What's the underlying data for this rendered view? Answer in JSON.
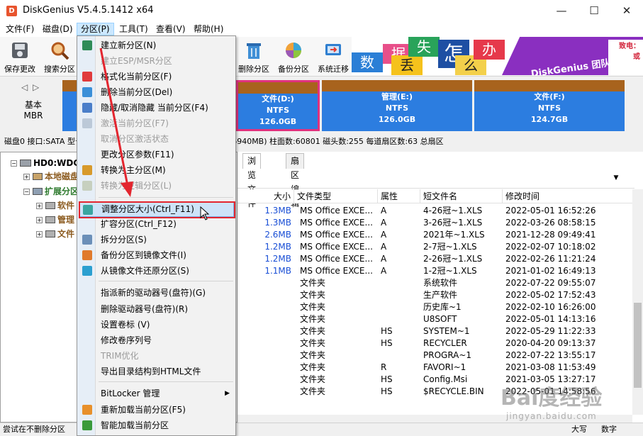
{
  "window": {
    "title": "DiskGenius V5.4.5.1412 x64",
    "minimize": "—",
    "maximize": "☐",
    "close": "✕"
  },
  "menubar": [
    "文件(F)",
    "磁盘(D)",
    "分区(P)",
    "工具(T)",
    "查看(V)",
    "帮助(H)"
  ],
  "toolbar": {
    "buttons": [
      {
        "label": "保存更改",
        "icon": "save-disk-icon"
      },
      {
        "label": "搜索分区",
        "icon": "magnifier-icon"
      },
      {
        "label": "删除分区",
        "icon": "trash-icon"
      },
      {
        "label": "备份分区",
        "icon": "backup-icon"
      },
      {
        "label": "系统迁移",
        "icon": "migrate-icon"
      }
    ],
    "banner": {
      "tiles": [
        "数",
        "据",
        "丢",
        "失",
        "怎",
        "么",
        "办"
      ],
      "slogan": "DiskGenius 团队为您服务",
      "right_line1": "致电：",
      "right_line2": "或"
    }
  },
  "diskbar": {
    "nav_left": "◁",
    "nav_right": "▷",
    "mbr_line1": "基本",
    "mbr_line2": "MBR",
    "partitions": [
      {
        "name": "文件(D:)",
        "fs": "NTFS",
        "size": "126.0GB"
      },
      {
        "name": "管理(E:)",
        "fs": "NTFS",
        "size": "126.0GB"
      },
      {
        "name": "文件(F:)",
        "fs": "NTFS",
        "size": "124.7GB"
      }
    ]
  },
  "disk_info": "磁盘0 接口:SATA  型号:WD-WCC2EP2L88C8  容量:465.8GB(476940MB)  柱面数:60801  磁头数:255  每道扇区数:63  总扇区",
  "tree": {
    "disk": "HD0:WDC",
    "items": [
      "本地磁盘",
      "扩展分区",
      "软件",
      "管理",
      "文件"
    ]
  },
  "right_panel": {
    "tabs": [
      "浏览文件",
      "扇区编辑"
    ],
    "columns": [
      "大小",
      "文件类型",
      "属性",
      "短文件名",
      "修改时间"
    ],
    "rows": [
      {
        "size": "1.3MB",
        "type": "MS Office EXCE...",
        "attr": "A",
        "short": "4-26冠~1.XLS",
        "time": "2022-05-01 16:52:26"
      },
      {
        "size": "1.3MB",
        "type": "MS Office EXCE...",
        "attr": "A",
        "short": "3-26冠~1.XLS",
        "time": "2022-03-26 08:58:15"
      },
      {
        "size": "2.6MB",
        "type": "MS Office EXCE...",
        "attr": "A",
        "short": "2021年~1.XLS",
        "time": "2021-12-28 09:49:41"
      },
      {
        "size": "1.2MB",
        "type": "MS Office EXCE...",
        "attr": "A",
        "short": "2-7冠~1.XLS",
        "time": "2022-02-07 10:18:02"
      },
      {
        "size": "1.2MB",
        "type": "MS Office EXCE...",
        "attr": "A",
        "short": "2-26冠~1.XLS",
        "time": "2022-02-26 11:21:24"
      },
      {
        "size": "1.1MB",
        "type": "MS Office EXCE...",
        "attr": "A",
        "short": "1-2冠~1.XLS",
        "time": "2021-01-02 16:49:13"
      },
      {
        "size": "",
        "type": "文件夹",
        "attr": "",
        "short": "系统软件",
        "time": "2022-07-22 09:55:07"
      },
      {
        "size": "",
        "type": "文件夹",
        "attr": "",
        "short": "生产软件",
        "time": "2022-05-02 17:52:43"
      },
      {
        "size": "",
        "type": "文件夹",
        "attr": "",
        "short": "历史库~1",
        "time": "2022-02-10 16:26:00"
      },
      {
        "size": "",
        "type": "文件夹",
        "attr": "",
        "short": "U8SOFT",
        "time": "2022-05-01 14:13:16"
      },
      {
        "size": "",
        "type": "文件夹",
        "attr": "HS",
        "short": "SYSTEM~1",
        "time": "2022-05-29 11:22:33"
      },
      {
        "size": "",
        "type": "文件夹",
        "attr": "HS",
        "short": "RECYCLER",
        "time": "2020-04-20 09:13:37"
      },
      {
        "size": "",
        "type": "文件夹",
        "attr": "",
        "short": "PROGRA~1",
        "time": "2022-07-22 13:55:17"
      },
      {
        "size": "",
        "type": "文件夹",
        "attr": "R",
        "short": "FAVORI~1",
        "time": "2021-03-08 11:53:49"
      },
      {
        "size": "",
        "type": "文件夹",
        "attr": "HS",
        "short": "Config.Msi",
        "time": "2021-03-05 13:27:17"
      },
      {
        "size": "",
        "type": "文件夹",
        "attr": "HS",
        "short": "$RECYCLE.BIN",
        "time": "2022-05-01 14:58:56"
      }
    ]
  },
  "statusbar": {
    "left": "尝试在不删除分区",
    "caps": "大写",
    "num": "数字"
  },
  "context_menu": {
    "items": [
      {
        "label": "建立新分区(N)",
        "disabled": false,
        "icon": "new-partition-icon",
        "color": "#2e8b57"
      },
      {
        "label": "建立ESP/MSR分区",
        "disabled": true,
        "icon": "",
        "color": ""
      },
      {
        "label": "格式化当前分区(F)",
        "disabled": false,
        "icon": "format-icon",
        "color": "#e03b3b"
      },
      {
        "label": "删除当前分区(Del)",
        "disabled": false,
        "icon": "trash-icon",
        "color": "#3a8fd8"
      },
      {
        "label": "隐藏/取消隐藏 当前分区(F4)",
        "disabled": false,
        "icon": "hide-icon",
        "color": "#4a7ec9"
      },
      {
        "label": "激活当前分区(F7)",
        "disabled": true,
        "icon": "activate-icon",
        "color": "#bcc9d8"
      },
      {
        "label": "取消分区激活状态",
        "disabled": true,
        "icon": "",
        "color": ""
      },
      {
        "label": "更改分区参数(F11)",
        "disabled": false,
        "icon": "",
        "color": ""
      },
      {
        "label": "转换为主分区(M)",
        "disabled": false,
        "icon": "convert-primary-icon",
        "color": "#d89a2b"
      },
      {
        "label": "转换为逻辑分区(L)",
        "disabled": true,
        "icon": "convert-logical-icon",
        "color": "#c7d0bf"
      },
      {
        "label": "调整分区大小(Ctrl_F11)",
        "disabled": false,
        "icon": "resize-icon",
        "color": "#3aa6a0"
      },
      {
        "label": "扩容分区(Ctrl_F12)",
        "disabled": false,
        "icon": "",
        "color": ""
      },
      {
        "label": "拆分分区(S)",
        "disabled": false,
        "icon": "split-icon",
        "color": "#6b8fb8"
      },
      {
        "label": "备份分区到镜像文件(I)",
        "disabled": false,
        "icon": "backup-image-icon",
        "color": "#e07a2b"
      },
      {
        "label": "从镜像文件还原分区(S)",
        "disabled": false,
        "icon": "restore-image-icon",
        "color": "#2b9fd0"
      },
      {
        "label": "指派新的驱动器号(盘符)(G)",
        "disabled": false,
        "icon": "",
        "color": ""
      },
      {
        "label": "删除驱动器号(盘符)(R)",
        "disabled": false,
        "icon": "",
        "color": ""
      },
      {
        "label": "设置卷标 (V)",
        "disabled": false,
        "icon": "",
        "color": ""
      },
      {
        "label": "修改卷序列号",
        "disabled": false,
        "icon": "",
        "color": ""
      },
      {
        "label": "TRIM优化",
        "disabled": true,
        "icon": "",
        "color": ""
      },
      {
        "label": "导出目录结构到HTML文件",
        "disabled": false,
        "icon": "",
        "color": ""
      },
      {
        "label": "BitLocker 管理",
        "disabled": false,
        "icon": "",
        "color": ""
      },
      {
        "label": "重新加载当前分区(F5)",
        "disabled": false,
        "icon": "reload-icon",
        "color": "#e8902b"
      },
      {
        "label": "智能加载当前分区",
        "disabled": false,
        "icon": "smart-load-icon",
        "color": "#3a9a3a"
      }
    ]
  },
  "watermark": {
    "main": "Bai度经验",
    "sub": "jingyan.baidu.com"
  },
  "colors": {
    "accent_red": "#e3262f",
    "partition_blue": "#2c7de0",
    "partition_top": "#a8631d",
    "menu_highlight": "#cde3f8"
  }
}
